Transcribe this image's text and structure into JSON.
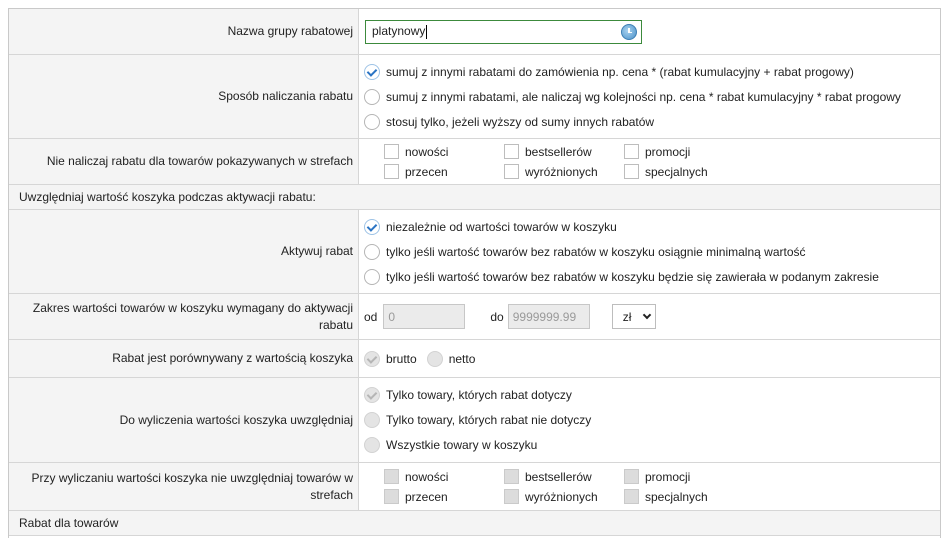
{
  "discount_name": {
    "label": "Nazwa grupy rabatowej",
    "value": "platynowy",
    "icon": "clock-icon"
  },
  "calc_method": {
    "label": "Sposób naliczania rabatu",
    "options": [
      {
        "label": "sumuj z innymi rabatami do zamówienia np. cena * (rabat kumulacyjny + rabat progowy)",
        "checked": true
      },
      {
        "label": "sumuj z innymi rabatami, ale naliczaj wg kolejności np. cena * rabat kumulacyjny * rabat progowy",
        "checked": false
      },
      {
        "label": "stosuj tylko, jeżeli wyższy od sumy innych rabatów",
        "checked": false
      }
    ]
  },
  "exclude_zones": {
    "label": "Nie naliczaj rabatu dla towarów pokazywanych w strefach",
    "items": [
      "nowości",
      "bestsellerów",
      "promocji",
      "przecen",
      "wyróżnionych",
      "specjalnych"
    ]
  },
  "section_cart": {
    "title": "Uwzględniaj wartość koszyka podczas aktywacji rabatu:"
  },
  "activate": {
    "label": "Aktywuj rabat",
    "options": [
      {
        "label": "niezależnie od wartości towarów w koszyku",
        "checked": true
      },
      {
        "label": "tylko jeśli wartość towarów bez rabatów w koszyku osiągnie minimalną wartość",
        "checked": false
      },
      {
        "label": "tylko jeśli wartość towarów bez rabatów w koszyku będzie się zawierała w podanym zakresie",
        "checked": false
      }
    ]
  },
  "range": {
    "label": "Zakres wartości towarów w koszyku wymagany do aktywacji rabatu",
    "from_label": "od",
    "from_value": "0",
    "to_label": "do",
    "to_value": "9999999.99",
    "currency": "zł"
  },
  "compare": {
    "label": "Rabat jest porównywany z wartością koszyka",
    "options": [
      {
        "label": "brutto",
        "checked": true
      },
      {
        "label": "netto",
        "checked": false
      }
    ]
  },
  "include": {
    "label": "Do wyliczenia wartości koszyka uwzględniaj",
    "options": [
      {
        "label": "Tylko towary, których rabat dotyczy",
        "checked": true
      },
      {
        "label": "Tylko towary, których rabat nie dotyczy",
        "checked": false
      },
      {
        "label": "Wszystkie towary w koszyku",
        "checked": false
      }
    ]
  },
  "cart_exclude": {
    "label": "Przy wyliczaniu wartości koszyka nie uwzględniaj towarów w strefach",
    "items": [
      "nowości",
      "bestsellerów",
      "promocji",
      "przecen",
      "wyróżnionych",
      "specjalnych"
    ]
  },
  "section_products": {
    "title": "Rabat dla towarów"
  }
}
